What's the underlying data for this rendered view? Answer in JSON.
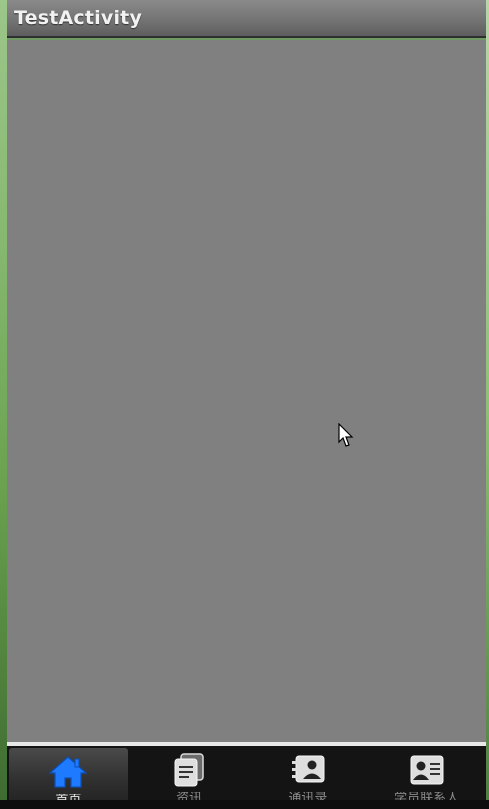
{
  "window": {
    "title": "TestActivity"
  },
  "tabs": [
    {
      "label": "首页",
      "icon": "home-icon",
      "active": true
    },
    {
      "label": "资讯",
      "icon": "documents-icon",
      "active": false
    },
    {
      "label": "通讯录",
      "icon": "contacts-book-icon",
      "active": false
    },
    {
      "label": "学员联系人",
      "icon": "user-card-icon",
      "active": false
    }
  ],
  "colors": {
    "content_bg": "#808080",
    "active_icon": "#1e7bff",
    "inactive_icon": "#d8d8d8"
  }
}
